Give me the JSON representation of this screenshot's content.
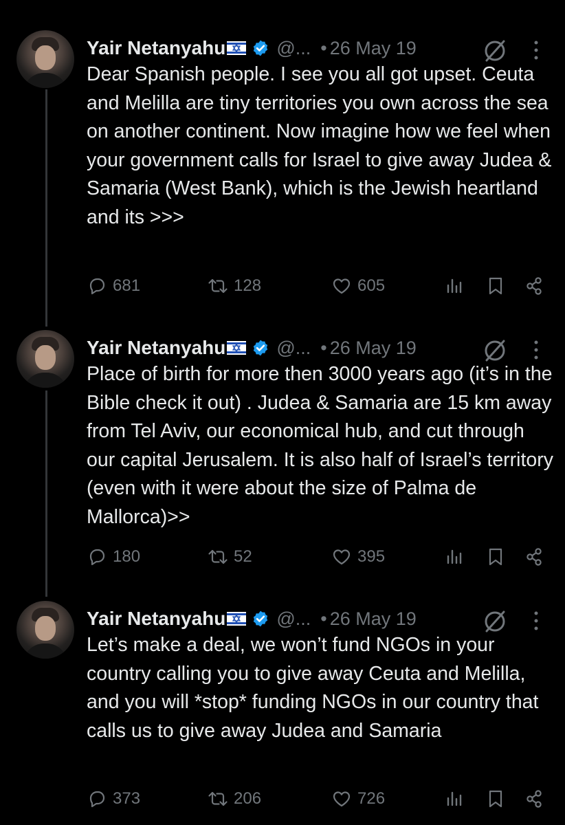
{
  "tweets": [
    {
      "name": "Yair Netanyahu",
      "handle": "@...",
      "dot": "•",
      "date": "26 May 19",
      "text": "Dear Spanish people. I see you all got upset. Ceuta and Melilla are tiny territories you own across the sea on another continent. Now imagine how we feel when your government calls for Israel to give away Judea & Samaria (West Bank), which is the Jewish heartland and its >>>",
      "replies": "681",
      "retweets": "128",
      "likes": "605"
    },
    {
      "name": "Yair Netanyahu",
      "handle": "@...",
      "dot": "•",
      "date": "26 May 19",
      "text": "Place of birth for more then 3000 years ago (it’s in the Bible check it out) . Judea & Samaria are 15 km away from Tel Aviv, our economical hub, and cut through our capital Jerusalem. It is also half of Israel’s territory (even with it were about the size of Palma de Mallorca)>>",
      "replies": "180",
      "retweets": "52",
      "likes": "395"
    },
    {
      "name": "Yair Netanyahu",
      "handle": "@...",
      "dot": "•",
      "date": "26 May 19",
      "text": "Let’s make a deal, we won’t fund NGOs in your country calling you to give away Ceuta and Melilla, and you will *stop* funding NGOs in our country that calls us to give away Judea and Samaria",
      "replies": "373",
      "retweets": "206",
      "likes": "726"
    }
  ],
  "colors": {
    "background": "#000000",
    "text": "#e7e9ea",
    "muted": "#71767b",
    "verified": "#1d9bf0",
    "flag_blue": "#1f4fb4",
    "thread_line": "#333639"
  },
  "icons": [
    "israel-flag-icon",
    "verified-badge-icon",
    "grok-icon",
    "more-icon",
    "reply-icon",
    "retweet-icon",
    "like-icon",
    "views-icon",
    "bookmark-icon",
    "share-icon"
  ]
}
